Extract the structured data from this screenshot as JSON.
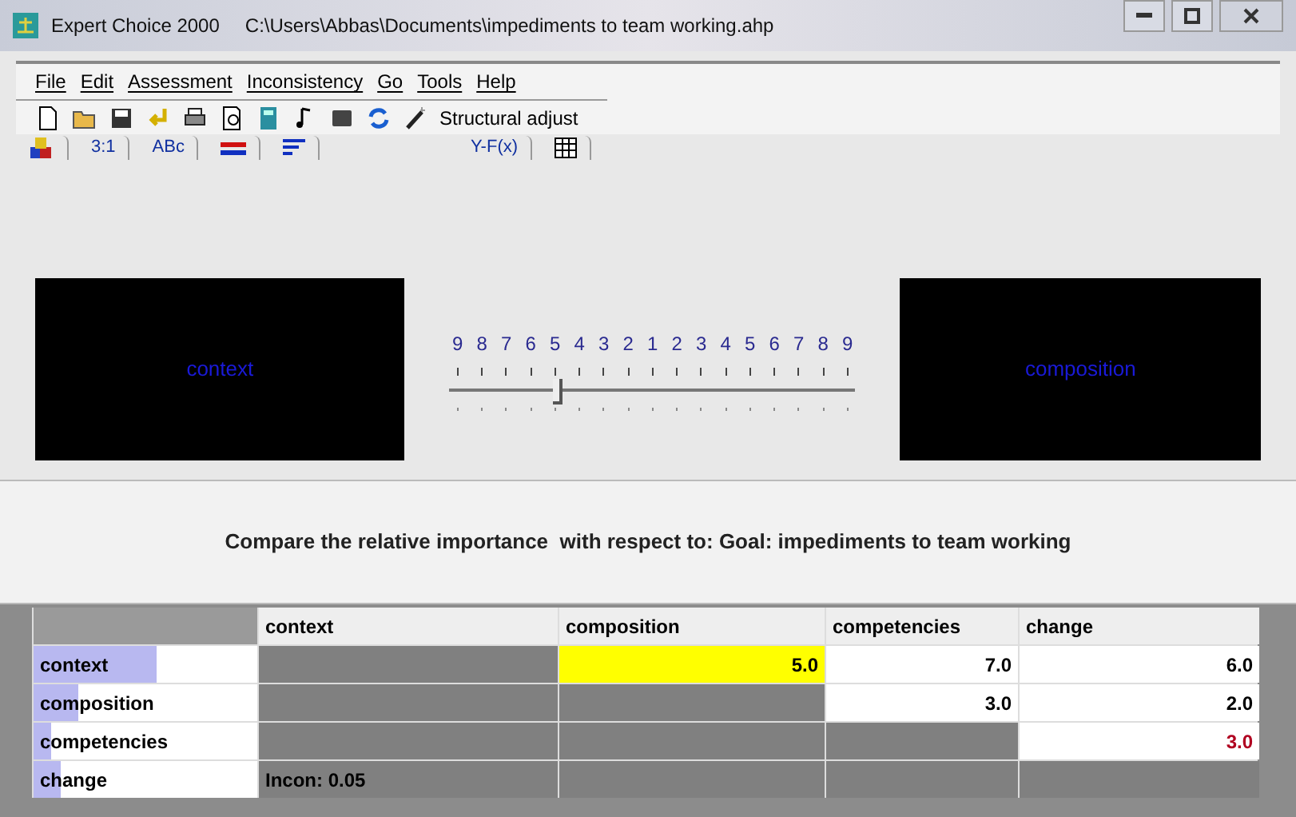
{
  "window": {
    "app": "Expert Choice 2000",
    "path": "C:\\Users\\Abbas\\Documents\\impediments to team working.ahp"
  },
  "menu": [
    "File",
    "Edit",
    "Assessment",
    "Inconsistency",
    "Go",
    "Tools",
    "Help"
  ],
  "toolbar": {
    "button": "Structural adjust"
  },
  "tabs": [
    {
      "kind": "icon"
    },
    {
      "kind": "text",
      "label": "3:1"
    },
    {
      "kind": "text",
      "label": "ABc"
    },
    {
      "kind": "icon"
    },
    {
      "kind": "icon"
    },
    {
      "kind": "text",
      "label": "Y-F(x)"
    },
    {
      "kind": "icon"
    }
  ],
  "left_box": "context",
  "right_box": "composition",
  "scale": {
    "labels": [
      "9",
      "8",
      "7",
      "6",
      "5",
      "4",
      "3",
      "2",
      "1",
      "2",
      "3",
      "4",
      "5",
      "6",
      "7",
      "8",
      "9"
    ],
    "level": 0.25
  },
  "prompt": "Compare the relative importance  with respect to: Goal: impediments to team working",
  "table": {
    "columns": [
      "context",
      "composition",
      "competencies",
      "change"
    ],
    "rows": [
      {
        "label": "context",
        "level": 0.55,
        "cells": [
          {
            "kind": "empty"
          },
          {
            "kind": "number",
            "text": "5.0",
            "selected": true,
            "color": "#000000"
          },
          {
            "kind": "number",
            "text": "7.0",
            "selected": false,
            "color": "#000000"
          },
          {
            "kind": "number",
            "text": "6.0",
            "selected": false,
            "color": "#000000"
          }
        ]
      },
      {
        "label": "composition",
        "level": 0.2,
        "cells": [
          {
            "kind": "empty"
          },
          {
            "kind": "empty"
          },
          {
            "kind": "number",
            "text": "3.0",
            "selected": false,
            "color": "#000000"
          },
          {
            "kind": "number",
            "text": "2.0",
            "selected": false,
            "color": "#000000"
          }
        ]
      },
      {
        "label": "competencies",
        "level": 0.08,
        "cells": [
          {
            "kind": "empty"
          },
          {
            "kind": "empty"
          },
          {
            "kind": "empty"
          },
          {
            "kind": "number",
            "text": "3.0",
            "selected": false,
            "color": "#b00020"
          }
        ]
      },
      {
        "label": "change",
        "level": 0.12,
        "cells": [
          {
            "kind": "note",
            "text": "Incon: 0.05"
          },
          {
            "kind": "empty"
          },
          {
            "kind": "empty"
          },
          {
            "kind": "empty"
          }
        ]
      }
    ]
  }
}
